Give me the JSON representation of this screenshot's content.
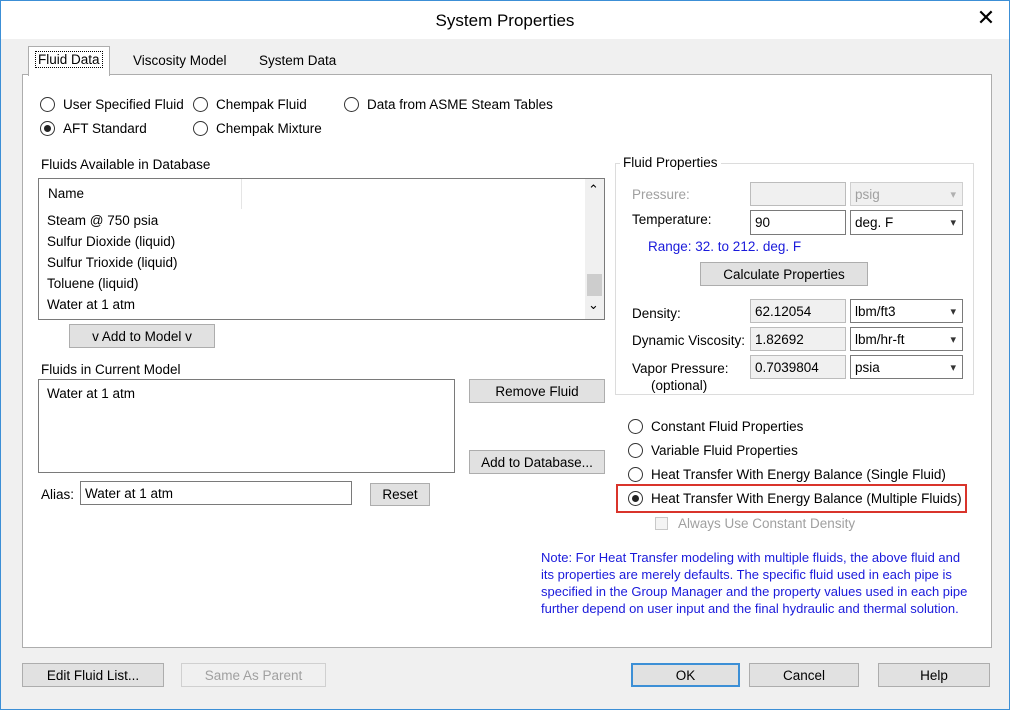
{
  "window": {
    "title": "System Properties",
    "close_glyph": "✕"
  },
  "tabs": [
    {
      "label": "Fluid Data"
    },
    {
      "label": "Viscosity Model"
    },
    {
      "label": "System Data"
    }
  ],
  "fluid_source": {
    "user_specified": "User Specified Fluid",
    "aft_standard": "AFT Standard",
    "chempak_fluid": "Chempak Fluid",
    "chempak_mixture": "Chempak Mixture",
    "asme": "Data from ASME Steam Tables",
    "selected": "AFT Standard"
  },
  "database": {
    "label": "Fluids Available in Database",
    "column": "Name",
    "items": [
      "Steam @ 750 psia",
      "Sulfur Dioxide (liquid)",
      "Sulfur Trioxide (liquid)",
      "Toluene (liquid)",
      "Water at 1 atm"
    ],
    "add_button": "v  Add to Model  v"
  },
  "current_model": {
    "label": "Fluids in Current Model",
    "items": [
      "Water at 1 atm"
    ],
    "remove_button": "Remove Fluid",
    "add_db_button": "Add to Database...",
    "alias_label": "Alias:",
    "alias_value": "Water at 1 atm",
    "reset_button": "Reset"
  },
  "fluid_properties": {
    "group_label": "Fluid Properties",
    "pressure_label": "Pressure:",
    "pressure_value": "",
    "pressure_unit": "psig",
    "temperature_label": "Temperature:",
    "temperature_value": "90",
    "temperature_unit": "deg. F",
    "range_text": "Range: 32. to 212. deg. F",
    "calc_button": "Calculate Properties",
    "density_label": "Density:",
    "density_value": "62.12054",
    "density_unit": "lbm/ft3",
    "viscosity_label": "Dynamic Viscosity:",
    "viscosity_value": "1.82692",
    "viscosity_unit": "lbm/hr-ft",
    "vapor_label": "Vapor Pressure:",
    "vapor_sub": "(optional)",
    "vapor_value": "0.7039804",
    "vapor_unit": "psia"
  },
  "property_mode": {
    "constant": "Constant Fluid Properties",
    "variable": "Variable Fluid Properties",
    "ht_single": "Heat Transfer With Energy Balance (Single Fluid)",
    "ht_multiple": "Heat Transfer With Energy Balance (Multiple Fluids)",
    "selected": "Heat Transfer With Energy Balance (Multiple Fluids)",
    "always_constant_density": "Always Use Constant Density",
    "highlight_color": "#d9342b"
  },
  "note": {
    "lines": [
      "Note: For Heat Transfer modeling with multiple fluids, the above fluid and",
      "its properties are merely defaults. The specific fluid used in each pipe is",
      "specified in the Group Manager and the property values used in each pipe",
      "further depend on user input and the final hydraulic and thermal solution."
    ]
  },
  "footer": {
    "edit_list": "Edit Fluid List...",
    "same_as_parent": "Same As Parent",
    "ok": "OK",
    "cancel": "Cancel",
    "help": "Help"
  },
  "icons": {
    "radio_on": "radio-selected-icon",
    "chevron_down": "▾",
    "scroll_up": "⌃",
    "scroll_down": "⌄"
  }
}
